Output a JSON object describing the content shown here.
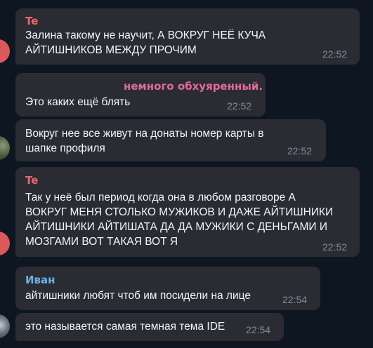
{
  "messages": [
    {
      "sender": "Te",
      "text": "Залина такому не научит, А ВОКРУГ НЕЁ КУЧА\nАЙТИШНИКОВ МЕЖДУ ПРОЧИМ",
      "time": "22:52"
    },
    {
      "sender": "немного обхуяренный.",
      "text": "Это каких ещё блять",
      "time": "22:52"
    },
    {
      "sender": "",
      "text": "Вокруг нее все живут на донаты номер карты в\nшапке профиля",
      "time": "22:52"
    },
    {
      "sender": "Te",
      "text": "Так у неё был период когда она в любом разговоре А\nВОКРУГ МЕНЯ СТОЛЬКО МУЖИКОВ И ДАЖЕ АЙТИШНИКИ\nАЙТИШНИКИ АЙТИШАТА ДА ДА МУЖИКИ С ДЕНЬГАМИ И\nМОЗГАМИ ВОТ ТАКАЯ ВОТ Я",
      "time": "22:52"
    },
    {
      "sender": "Иван",
      "text": "айтишники любят чтоб им посидели на лице",
      "time": "22:54"
    },
    {
      "sender": "",
      "text": "это называется самая темная тема IDE",
      "time": "22:54"
    }
  ],
  "colors": {
    "background": "#0e1621",
    "bubble": "#2b2c33",
    "sender_red": "#e8676b",
    "sender_pink": "#e06c96",
    "sender_blue": "#6ab3e8",
    "time": "#838c97"
  }
}
